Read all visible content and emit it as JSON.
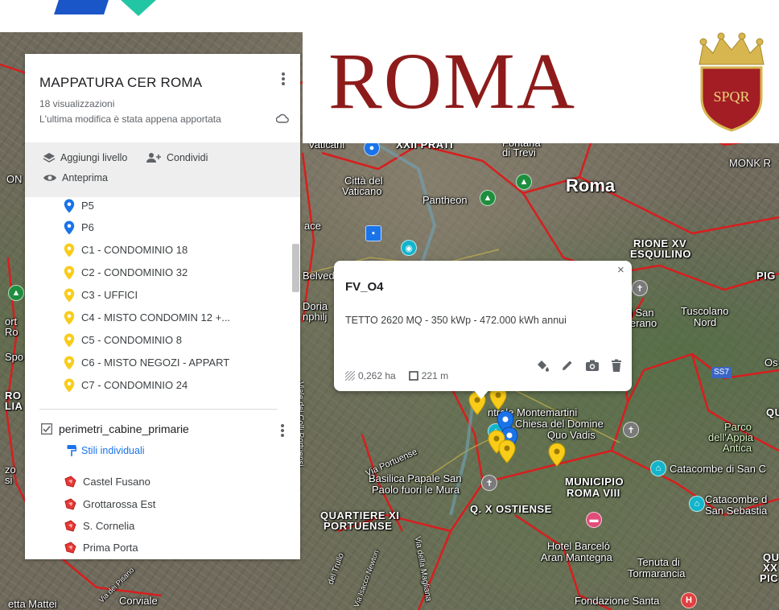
{
  "panel": {
    "title": "MAPPATURA CER ROMA",
    "views": "18 visualizzazioni",
    "last_edit": "L'ultima modifica è stata appena apportata",
    "toolbar": {
      "add_layer": "Aggiungi livello",
      "share": "Condividi",
      "preview": "Anteprima"
    },
    "items": [
      {
        "label": "P5",
        "pin_color": "#1a73e8"
      },
      {
        "label": "P6",
        "pin_color": "#1a73e8"
      },
      {
        "label": "C1 - CONDOMINIO 18",
        "pin_color": "#f9cc1a"
      },
      {
        "label": "C2 - CONDOMINIO 32",
        "pin_color": "#f9cc1a"
      },
      {
        "label": "C3 - UFFICI",
        "pin_color": "#f9cc1a"
      },
      {
        "label": "C4  - MISTO CONDOMIN 12 +...",
        "pin_color": "#f9cc1a"
      },
      {
        "label": "C5 - CONDOMINIO 8",
        "pin_color": "#f9cc1a"
      },
      {
        "label": "C6 - MISTO NEGOZI - APPART",
        "pin_color": "#f9cc1a"
      },
      {
        "label": "C7 - CONDOMINIO 24",
        "pin_color": "#f9cc1a"
      }
    ],
    "layer2": {
      "name": "perimetri_cabine_primarie",
      "checked": true,
      "style_link": "Stili individuali",
      "items": [
        "Castel Fusano",
        "Grottarossa Est",
        "S. Cornelia",
        "Prima Porta"
      ]
    }
  },
  "banner": {
    "word": "ROMA",
    "crest_text": "SPQR"
  },
  "popup": {
    "title": "FV_O4",
    "description": "TETTO 2620 MQ - 350 kWp - 472.000 kWh annui",
    "area": "0,262 ha",
    "perimeter": "221 m",
    "close": "×"
  },
  "map_labels": {
    "roma": "Roma",
    "vaticani": "Vaticani",
    "xxii_prati": "XXII PRATI",
    "fontana": "Fontana",
    "di_trevi": "di Trevi",
    "monk": "MONK R",
    "citta_del": "Città del",
    "vaticano": "Vaticano",
    "pantheon": "Pantheon",
    "rione_xv": "RIONE XV",
    "esquilino": "ESQUILINO",
    "pig": "PIG",
    "on": "ON",
    "ace": "ace",
    "belved": "Belved",
    "doria": "Doria",
    "nphilj": "nphilj",
    "san": "i San",
    "erano": "erano",
    "tuscolano": "Tuscolano",
    "nord": "Nord",
    "os": "Os",
    "ss7": "SS7",
    "ort": "ort",
    "ro": "Ro",
    "spo": "Spo",
    "ro2": "RO",
    "lia": "LIA",
    "zo": "zo",
    "si": "si",
    "centrale": "ntrale Montemartini",
    "chiesa": "Chiesa del Domine",
    "quo_vadis": "Quo Vadis",
    "parco": "Parco",
    "dell_appia": "dell'Appia",
    "antica": "Antica",
    "qu": "QU",
    "catacombe_san_c": "Catacombe di San C",
    "catacombe_d": "Catacombe d",
    "san_sebastia": "San Sebastia",
    "basilica": "Basilica Papale San",
    "paolo": "Paolo fuori le Mura",
    "municipio": "MUNICIPIO",
    "roma_viii": "ROMA VIII",
    "q_x_ostiense": "Q. X OSTIENSE",
    "quartiere_xi": "QUARTIERE XI",
    "portuense": "PORTUENSE",
    "via_portuense": "Via Portuense",
    "viale_colli": "Viale dei Colli Portuensi",
    "hotel": "Hotel Barceló",
    "aran": "Aran Mantegna",
    "tenuta": "Tenuta di",
    "tormarancia": "Tormarancia",
    "qu_xx_pi": "QU",
    "xx": "XX",
    "pi": "PIC",
    "fondazione": "Fondazione Santa",
    "etta_mattei": "etta Mattei",
    "corviale": "Corviale",
    "via_magliana": "Via della Magliana",
    "del_trullo": "del Trullo",
    "newton": "Via Isacco Newton",
    "via_dei_pisano": "Via dei Pisano"
  }
}
